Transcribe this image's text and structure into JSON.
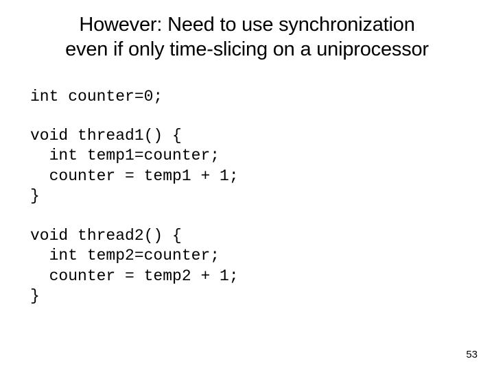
{
  "title_line1": "However: Need to use synchronization",
  "title_line2": "even if only time-slicing on a uniprocessor",
  "code1": "int counter=0;",
  "code2": "void thread1() {\n  int temp1=counter;\n  counter = temp1 + 1;\n}",
  "code3": "void thread2() {\n  int temp2=counter;\n  counter = temp2 + 1;\n}",
  "page_number": "53"
}
